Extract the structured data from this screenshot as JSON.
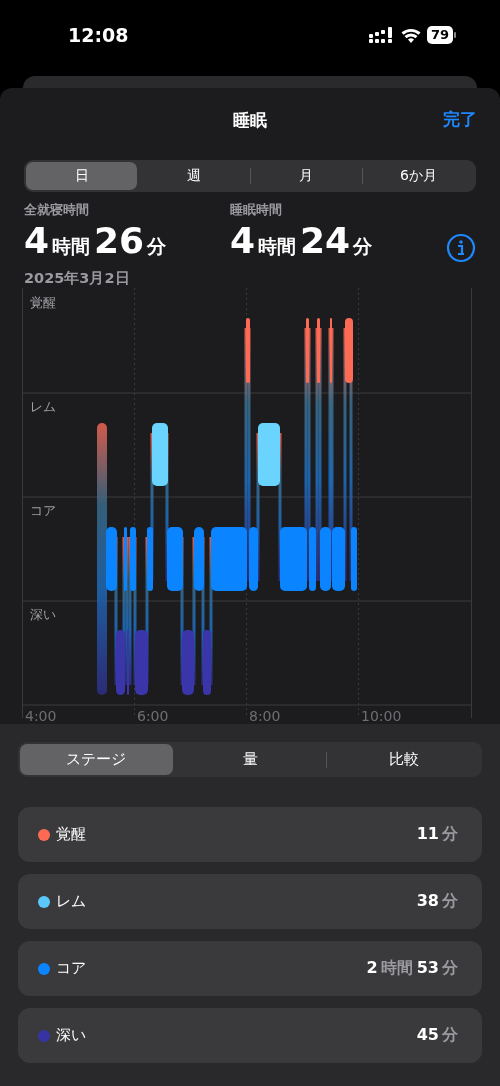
{
  "status_bar": {
    "time": "12:08",
    "battery": "79"
  },
  "header": {
    "title": "睡眠",
    "done": "完了"
  },
  "period_tabs": [
    {
      "label": "日",
      "selected": true
    },
    {
      "label": "週",
      "selected": false
    },
    {
      "label": "月",
      "selected": false
    },
    {
      "label": "6か月",
      "selected": false
    }
  ],
  "summary": [
    {
      "label": "全就寝時間",
      "parts": [
        {
          "kind": "number",
          "text": "4"
        },
        {
          "kind": "unit",
          "text": "時間"
        },
        {
          "kind": "number",
          "text": "26"
        },
        {
          "kind": "unit",
          "text": "分"
        }
      ]
    },
    {
      "label": "睡眠時間",
      "parts": [
        {
          "kind": "number",
          "text": "4"
        },
        {
          "kind": "unit",
          "text": "時間"
        },
        {
          "kind": "number",
          "text": "24"
        },
        {
          "kind": "unit",
          "text": "分"
        }
      ]
    }
  ],
  "date": "2025年3月2日",
  "chart": {
    "stage_labels": [
      "覚醒",
      "レム",
      "コア",
      "深い"
    ],
    "time_labels": [
      "4:00",
      "6:00",
      "8:00",
      "10:00"
    ]
  },
  "view_tabs": [
    {
      "label": "ステージ",
      "selected": true
    },
    {
      "label": "量",
      "selected": false
    },
    {
      "label": "比較",
      "selected": false
    }
  ],
  "stages": [
    {
      "name": "覚醒",
      "color": "#ff6a55",
      "parts": [
        {
          "kind": "number",
          "text": "11"
        },
        {
          "kind": "unit",
          "text": "分"
        }
      ]
    },
    {
      "name": "レム",
      "color": "#5ac8fa",
      "parts": [
        {
          "kind": "number",
          "text": "38"
        },
        {
          "kind": "unit",
          "text": "分"
        }
      ]
    },
    {
      "name": "コア",
      "color": "#0a84ff",
      "parts": [
        {
          "kind": "number",
          "text": "2"
        },
        {
          "kind": "unit",
          "text": "時間"
        },
        {
          "kind": "number",
          "text": "53"
        },
        {
          "kind": "unit",
          "text": "分"
        }
      ]
    },
    {
      "name": "深い",
      "color": "#3634a3",
      "parts": [
        {
          "kind": "number",
          "text": "45"
        },
        {
          "kind": "unit",
          "text": "分"
        }
      ]
    }
  ]
}
